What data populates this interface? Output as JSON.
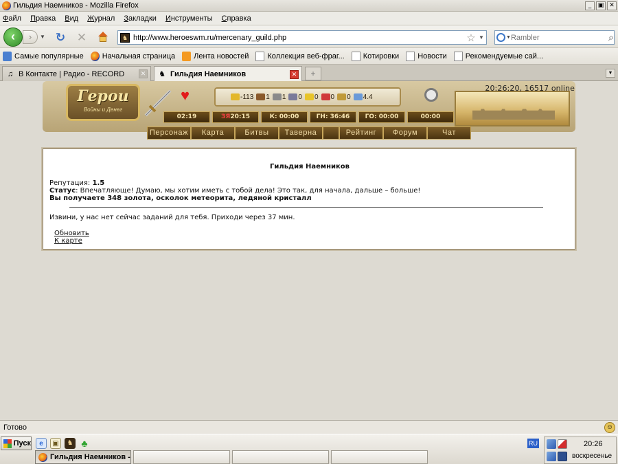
{
  "window": {
    "title": "Гильдия Наемников - Mozilla Firefox",
    "controls": [
      "_",
      "▣",
      "✕"
    ]
  },
  "menu": [
    "Файл",
    "Правка",
    "Вид",
    "Журнал",
    "Закладки",
    "Инструменты",
    "Справка"
  ],
  "nav": {
    "url": "http://www.heroeswm.ru/mercenary_guild.php",
    "search_placeholder": "Rambler"
  },
  "bookmarks": [
    {
      "label": "Самые популярные",
      "icon": "star"
    },
    {
      "label": "Начальная страница",
      "icon": "firefox"
    },
    {
      "label": "Лента новостей",
      "icon": "rss"
    },
    {
      "label": "Коллекция веб-фраг...",
      "icon": "page"
    },
    {
      "label": "Котировки",
      "icon": "page"
    },
    {
      "label": "Новости",
      "icon": "page"
    },
    {
      "label": "Рекомендуемые сай...",
      "icon": "page"
    }
  ],
  "tabs": [
    {
      "label": "В Контакте | Радио - RECORD",
      "icon": "music-note",
      "active": false
    },
    {
      "label": "Гильдия Наемников",
      "icon": "heroes-site",
      "active": true
    }
  ],
  "game": {
    "server_status": "20:26:20, 16517 online",
    "logo_title": "Герои",
    "logo_subtitle": "Войны и Денег",
    "resources": [
      {
        "value": "-113",
        "icon": "gold",
        "color": "#e3b72a"
      },
      {
        "value": "1",
        "icon": "wood",
        "color": "#8a5a2a"
      },
      {
        "value": "1",
        "icon": "ore",
        "color": "#8a8a8a"
      },
      {
        "value": "0",
        "icon": "mercury",
        "color": "#7a7a9a"
      },
      {
        "value": "0",
        "icon": "sulfur",
        "color": "#e8c42a"
      },
      {
        "value": "0",
        "icon": "crystal",
        "color": "#d03a3a"
      },
      {
        "value": "0",
        "icon": "gems",
        "color": "#c09a3a"
      },
      {
        "value": "4.4",
        "icon": "diamond",
        "color": "#6a9ad8"
      }
    ],
    "timers": [
      {
        "value": "02:19",
        "warn_prefix": ""
      },
      {
        "value": "20:15",
        "warn_prefix": "ЗЯ"
      },
      {
        "value": "К: 00:00",
        "warn_prefix": ""
      },
      {
        "value": "ГН: 36:46",
        "warn_prefix": ""
      },
      {
        "value": "ГО: 00:00",
        "warn_prefix": ""
      },
      {
        "value": "00:00",
        "warn_prefix": ""
      }
    ],
    "nav": [
      "Персонаж",
      "Карта",
      "Битвы",
      "Таверна",
      "Рейтинг",
      "Форум",
      "Чат"
    ]
  },
  "guild": {
    "title": "Гильдия Наемников",
    "reputation_label": "Репутация:",
    "reputation_value": "1.5",
    "status_label": "Статус",
    "status_text": ": Впечатляюще! Думаю, мы хотим иметь с тобой дела! Это так, для начала, дальше – больше!",
    "reward_text": "Вы получаете 348 золота, осколок метеорита, ледяной кристалл",
    "wait_text": "Извини, у нас нет сейчас заданий для тебя. Приходи через 37 мин.",
    "link_refresh": "Обновить",
    "link_map": "К карте"
  },
  "statusbar": {
    "text": "Готово"
  },
  "taskbar": {
    "start_label": "Пуск",
    "active_window": "Гильдия Наемников -...",
    "lang": "RU",
    "time": "20:26",
    "weekday": "воскресенье"
  }
}
